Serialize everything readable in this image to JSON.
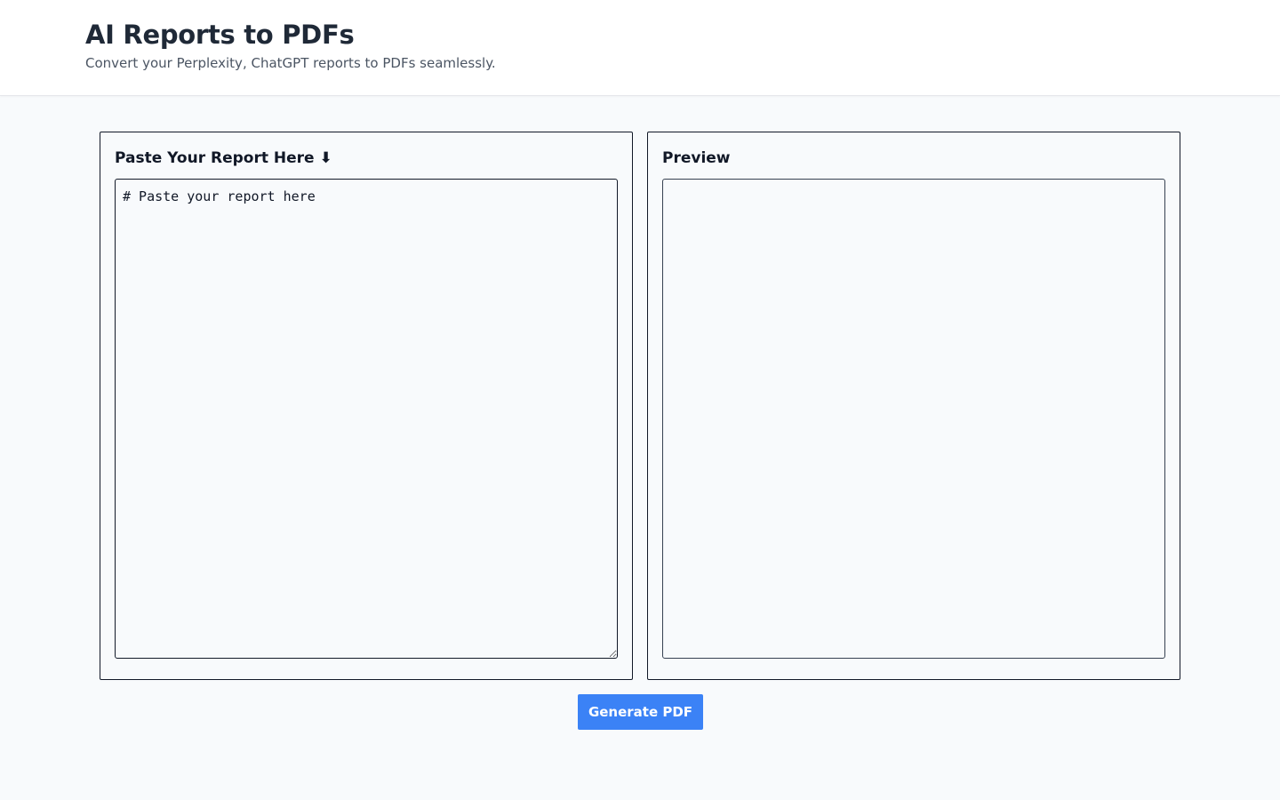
{
  "header": {
    "title": "AI Reports to PDFs",
    "subtitle": "Convert your Perplexity, ChatGPT reports to PDFs seamlessly."
  },
  "editor_panel": {
    "title": "Paste Your Report Here ⬇",
    "textarea_value": "# Paste your report here"
  },
  "preview_panel": {
    "title": "Preview"
  },
  "actions": {
    "generate_label": "Generate PDF"
  },
  "colors": {
    "accent": "#3b82f6",
    "background": "#f8fafc",
    "header_background": "#ffffff"
  }
}
